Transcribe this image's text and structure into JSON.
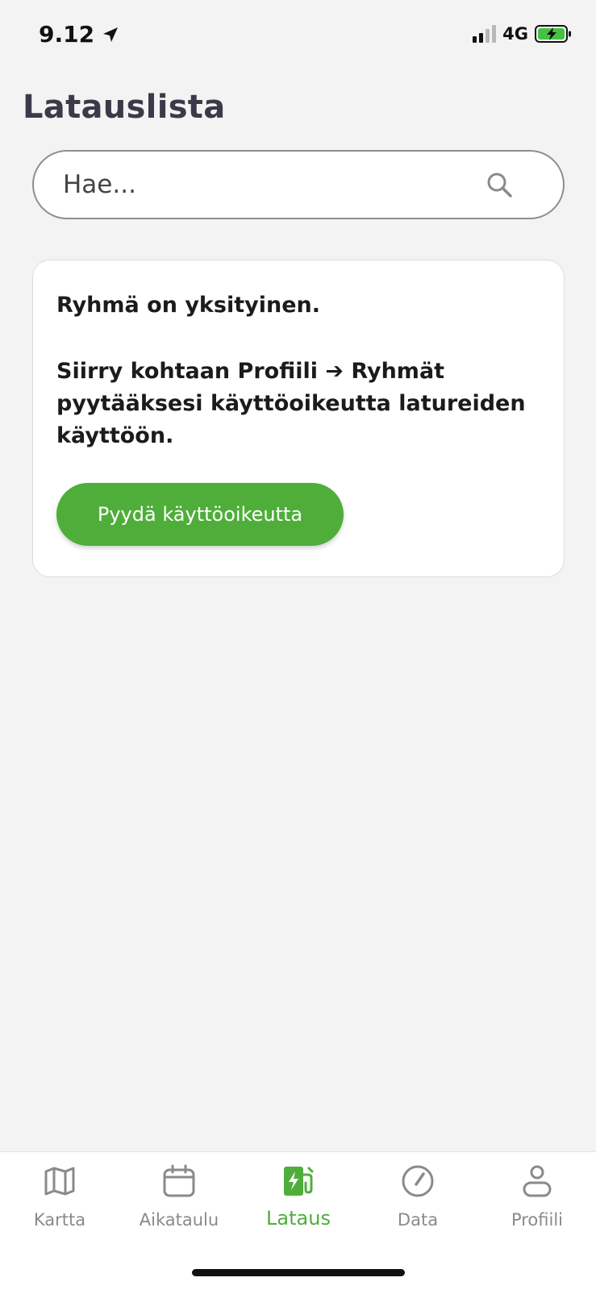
{
  "status_bar": {
    "time": "9.12",
    "network": "4G",
    "icons": [
      "location-arrow-icon",
      "signal-icon",
      "battery-charging-icon"
    ]
  },
  "page": {
    "title": "Latauslista"
  },
  "search": {
    "placeholder": "Hae...",
    "value": "",
    "icon": "search-icon"
  },
  "notice_card": {
    "title": "Ryhmä on yksityinen.",
    "body": "Siirry kohtaan Profiili ➔ Ryhmät pyytääksesi käyttöoikeutta latureiden käyttöön.",
    "button_label": "Pyydä käyttöoikeutta"
  },
  "tab_bar": {
    "tabs": [
      {
        "label": "Kartta",
        "icon": "map-icon"
      },
      {
        "label": "Aikataulu",
        "icon": "calendar-icon"
      },
      {
        "label": "Lataus",
        "icon": "ev-charger-icon"
      },
      {
        "label": "Data",
        "icon": "speedometer-icon"
      },
      {
        "label": "Profiili",
        "icon": "user-icon"
      }
    ],
    "active": "Lataus"
  },
  "colors": {
    "accent": "#4fae3a",
    "background": "#f3f3f3",
    "title": "#3a3a4a",
    "inactive_tab": "#8a8a8a"
  }
}
